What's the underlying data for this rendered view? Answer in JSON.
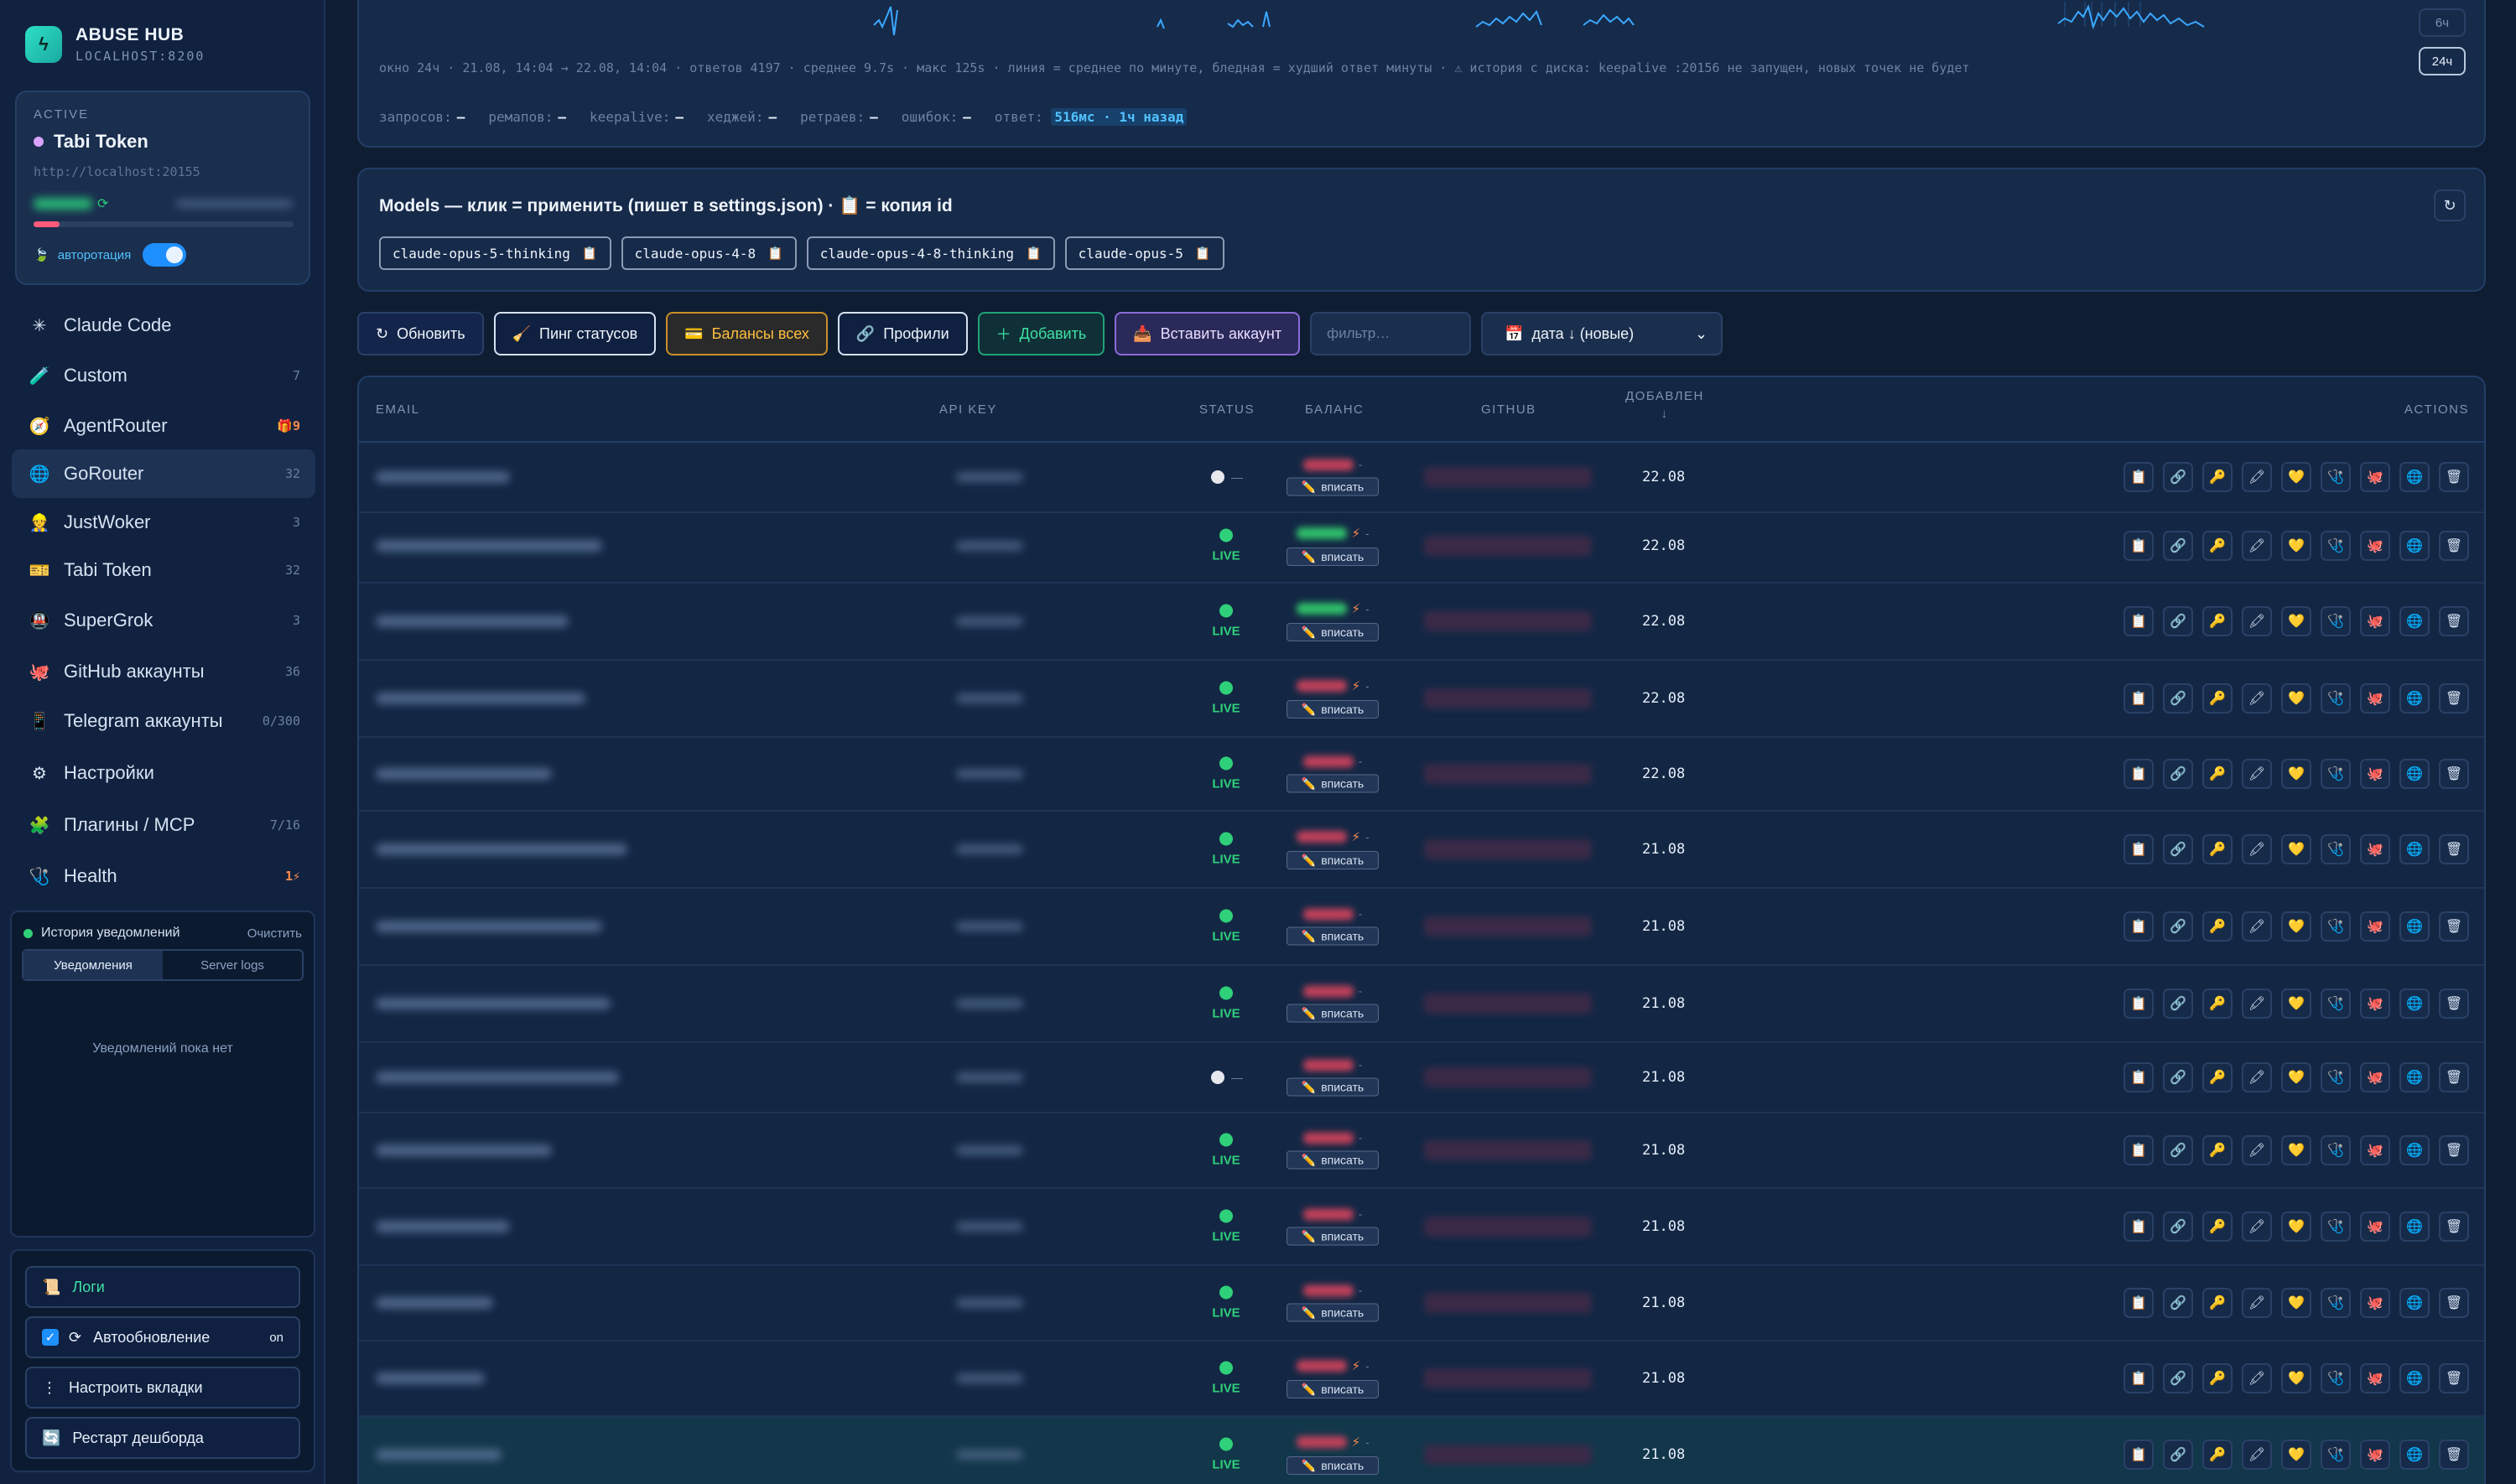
{
  "brand": {
    "title": "ABUSE HUB",
    "subtitle": "LOCALHOST:8200"
  },
  "active": {
    "label": "ACTIVE",
    "name": "Tabi Token",
    "url": "http://localhost:20155",
    "progress_fraction": 0.1,
    "autorotation_label": "авторотация",
    "autorotation_on": true
  },
  "nav": [
    {
      "icon": "✳",
      "icon_name": "asterisk-icon",
      "label": "Claude Code",
      "count": ""
    },
    {
      "icon": "🧪",
      "icon_name": "test-tube-icon",
      "label": "Custom",
      "count": "7"
    },
    {
      "icon": "🧭",
      "icon_name": "compass-icon",
      "label": "AgentRouter",
      "count": "🎁9",
      "warn": true
    },
    {
      "icon": "🌐",
      "icon_name": "globe-icon",
      "label": "GoRouter",
      "count": "32",
      "selected": true
    },
    {
      "icon": "👷",
      "icon_name": "worker-icon",
      "label": "JustWoker",
      "count": "3"
    },
    {
      "icon": "🎫",
      "icon_name": "ticket-icon",
      "label": "Tabi Token",
      "count": "32"
    },
    {
      "icon": "🚇",
      "icon_name": "metro-icon",
      "label": "SuperGrok",
      "count": "3"
    },
    {
      "icon": "🐙",
      "icon_name": "github-icon",
      "label": "GitHub аккаунты",
      "count": "36"
    },
    {
      "icon": "📱",
      "icon_name": "phone-icon",
      "label": "Telegram аккаунты",
      "count": "0/300"
    },
    {
      "icon": "⚙",
      "icon_name": "gear-icon",
      "label": "Настройки",
      "count": ""
    },
    {
      "icon": "🧩",
      "icon_name": "puzzle-icon",
      "label": "Плагины / MCP",
      "count": "7/16"
    },
    {
      "icon": "🩺",
      "icon_name": "stethoscope-icon",
      "label": "Health",
      "count": "1⚡",
      "warn": true
    }
  ],
  "notifications": {
    "title": "История уведомлений",
    "clear": "Очистить",
    "tabs": [
      "Уведомления",
      "Server logs"
    ],
    "empty": "Уведомлений пока нет"
  },
  "bottom": {
    "logs": "Логи",
    "autoupdate": "Автообновление",
    "autoupdate_state": "on",
    "tabs_config": "Настроить вкладки",
    "restart": "Рестарт дешборда"
  },
  "chart": {
    "info": "окно 24ч · 21.08, 14:04 → 22.08, 14:04 · ответов 4197 · среднее 9.7s · макс 125s · линия = среднее по минуте, бледная = худший ответ минуты · ⚠ история с диска: keepalive :20156 не запущен, новых точек не будет",
    "ranges": [
      "6ч",
      "24ч"
    ],
    "active_range": "24ч",
    "stats": {
      "requests_label": "запросов:",
      "requests": "—",
      "remaps_label": "ремапов:",
      "remaps": "—",
      "keepalive_label": "keepalive:",
      "keepalive": "—",
      "hedges_label": "хеджей:",
      "hedges": "—",
      "retries_label": "ретраев:",
      "retries": "—",
      "errors_label": "ошибок:",
      "errors": "—",
      "answer_label": "ответ:",
      "answer": "516мс · 1ч назад"
    }
  },
  "models": {
    "title": "Models — клик = применить (пишет в settings.json) · 📋 = копия id",
    "refresh_icon": "↻",
    "items": [
      "claude-opus-5-thinking",
      "claude-opus-4-8",
      "claude-opus-4-8-thinking",
      "claude-opus-5"
    ],
    "copy_icon": "📋"
  },
  "toolbar": {
    "refresh": "Обновить",
    "ping": "Пинг статусов",
    "balances": "Балансы всех",
    "profiles": "Профили",
    "add": "Добавить",
    "paste": "Вставить аккаунт",
    "filter_placeholder": "фильтр…",
    "sort": "дата ↓ (новые)"
  },
  "table": {
    "headers": {
      "email": "EMAIL",
      "api_key": "API KEY",
      "status": "STATUS",
      "balance": "БАЛАНС",
      "github": "GITHUB",
      "added": "ДОБАВЛЕН",
      "added_sort": "↓",
      "actions": "ACTIONS"
    },
    "live_label": "LIVE",
    "offline_label": "—",
    "write_label": "вписать",
    "action_icons": [
      "📋",
      "🔗",
      "🔑",
      "🖍",
      "💛",
      "🩺",
      "🐙",
      "🌐",
      "🗑"
    ],
    "rows": [
      {
        "status": "off",
        "date": "22.08",
        "bolt": false,
        "green": false
      },
      {
        "status": "live",
        "date": "22.08",
        "bolt": true,
        "green": true
      },
      {
        "status": "live",
        "date": "22.08",
        "bolt": true,
        "green": true
      },
      {
        "status": "live",
        "date": "22.08",
        "bolt": true,
        "green": false
      },
      {
        "status": "live",
        "date": "22.08",
        "bolt": false,
        "green": false
      },
      {
        "status": "live",
        "date": "21.08",
        "bolt": true,
        "green": false
      },
      {
        "status": "live",
        "date": "21.08",
        "bolt": false,
        "green": false
      },
      {
        "status": "live",
        "date": "21.08",
        "bolt": false,
        "green": false
      },
      {
        "status": "off",
        "date": "21.08",
        "bolt": false,
        "green": false
      },
      {
        "status": "live",
        "date": "21.08",
        "bolt": false,
        "green": false
      },
      {
        "status": "live",
        "date": "21.08",
        "bolt": false,
        "green": false
      },
      {
        "status": "live",
        "date": "21.08",
        "bolt": false,
        "green": false
      },
      {
        "status": "live",
        "date": "21.08",
        "bolt": true,
        "green": false
      },
      {
        "status": "live",
        "date": "21.08",
        "bolt": true,
        "green": false,
        "highlight": true
      }
    ]
  },
  "colors": {
    "accent": "#1e8fff",
    "live": "#2fd07a",
    "warn": "#ff8a4d",
    "chart_line": "#3aa8ff"
  }
}
